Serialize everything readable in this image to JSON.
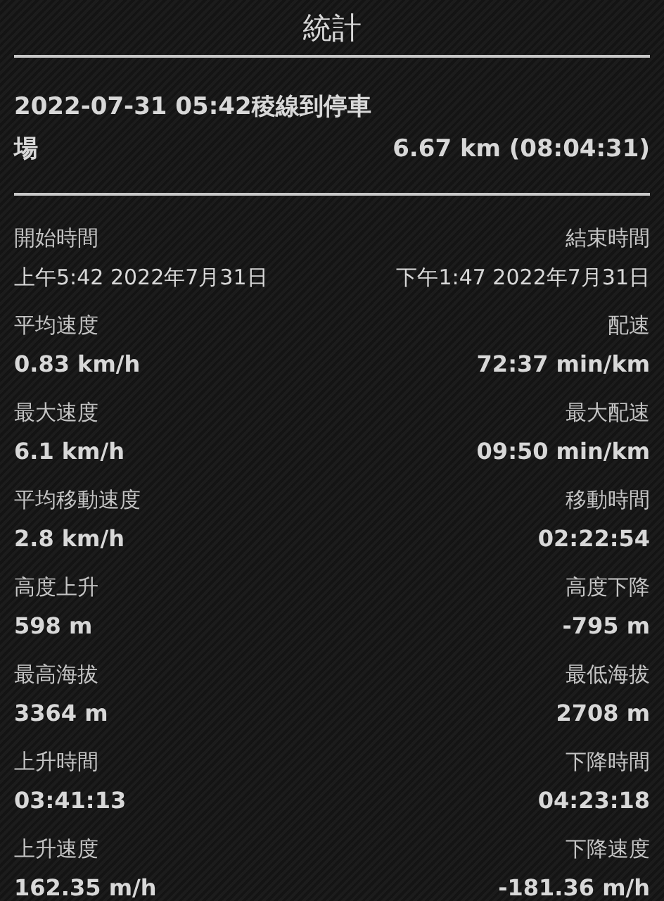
{
  "title": "統計",
  "trip": {
    "name": "2022-07-31 05:42稜線到停車場",
    "summary": "6.67 km (08:04:31)"
  },
  "stats": [
    {
      "left_label": "開始時間",
      "left_value": "上午5:42 2022年7月31日",
      "right_label": "結束時間",
      "right_value": "下午1:47 2022年7月31日",
      "kind": "time"
    },
    {
      "left_label": "平均速度",
      "left_value": "0.83 km/h",
      "right_label": "配速",
      "right_value": "72:37 min/km",
      "kind": "metric"
    },
    {
      "left_label": "最大速度",
      "left_value": "6.1 km/h",
      "right_label": "最大配速",
      "right_value": "09:50 min/km",
      "kind": "metric"
    },
    {
      "left_label": "平均移動速度",
      "left_value": "2.8 km/h",
      "right_label": "移動時間",
      "right_value": "02:22:54",
      "kind": "metric"
    },
    {
      "left_label": "高度上升",
      "left_value": "598 m",
      "right_label": "高度下降",
      "right_value": "-795 m",
      "kind": "metric"
    },
    {
      "left_label": "最高海拔",
      "left_value": "3364 m",
      "right_label": "最低海拔",
      "right_value": "2708 m",
      "kind": "metric"
    },
    {
      "left_label": "上升時間",
      "left_value": "03:41:13",
      "right_label": "下降時間",
      "right_value": "04:23:18",
      "kind": "metric"
    },
    {
      "left_label": "上升速度",
      "left_value": "162.35 m/h",
      "right_label": "下降速度",
      "right_value": "-181.36 m/h",
      "kind": "metric"
    }
  ]
}
